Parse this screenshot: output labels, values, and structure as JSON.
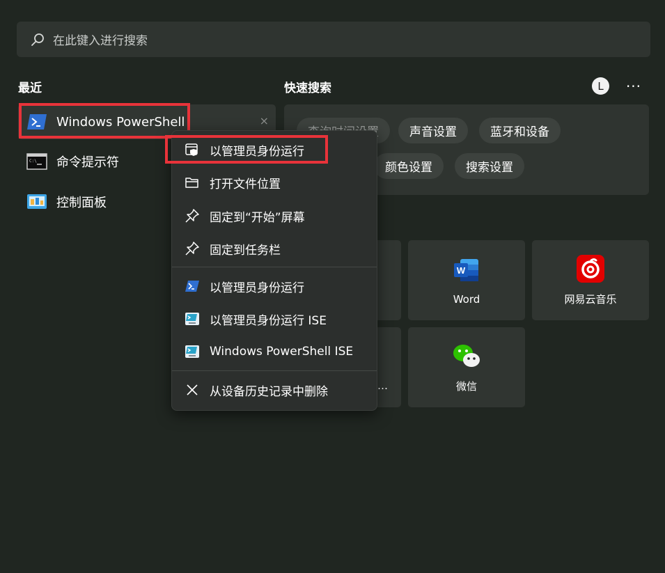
{
  "search": {
    "placeholder": "在此键入进行搜索"
  },
  "recent": {
    "title": "最近",
    "items": [
      {
        "label": "Windows PowerShell",
        "icon": "powershell-icon"
      },
      {
        "label": "命令提示符",
        "icon": "cmd-icon"
      },
      {
        "label": "控制面板",
        "icon": "control-panel-icon"
      }
    ],
    "dismiss": "×"
  },
  "quick_search": {
    "title": "快速搜索",
    "chips": [
      "声音设置",
      "蓝牙和设备",
      "颜色设置",
      "搜索设置"
    ],
    "obscured_chip": "查询时间设置"
  },
  "header": {
    "avatar_letter": "L",
    "more": "···"
  },
  "apps": [
    {
      "label": "Word",
      "icon": "word-icon"
    },
    {
      "label": "网易云音乐",
      "icon": "netease-music-icon"
    },
    {
      "label": "微信",
      "icon": "wechat-icon"
    },
    {
      "label": "…",
      "icon": ""
    }
  ],
  "context_menu": {
    "items": [
      {
        "label": "以管理员身份运行",
        "icon": "admin-shield-icon"
      },
      {
        "label": "打开文件位置",
        "icon": "folder-icon"
      },
      {
        "label": "固定到“开始”屏幕",
        "icon": "pin-icon"
      },
      {
        "label": "固定到任务栏",
        "icon": "pin-icon"
      },
      {
        "label": "以管理员身份运行",
        "icon": "powershell-icon"
      },
      {
        "label": "以管理员身份运行 ISE",
        "icon": "powershell-ise-icon"
      },
      {
        "label": "Windows PowerShell ISE",
        "icon": "powershell-ise-icon"
      },
      {
        "label": "从设备历史记录中删除",
        "icon": "close-icon"
      }
    ]
  },
  "colors": {
    "highlight": "#e8333a",
    "background": "#202621",
    "powershell": "#2f6fd1"
  }
}
